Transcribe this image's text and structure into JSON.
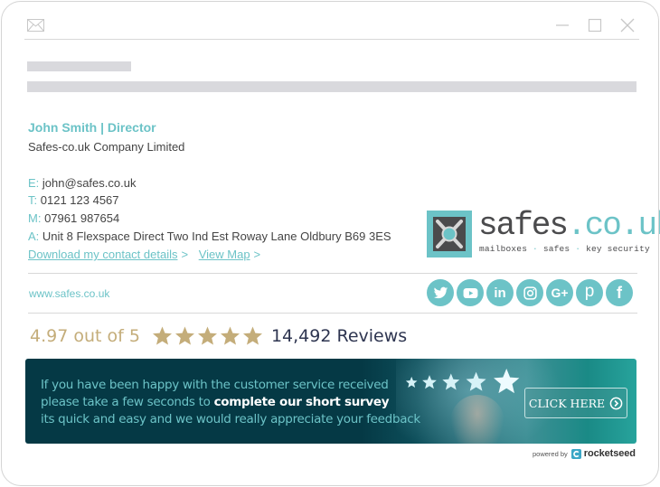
{
  "window": {
    "controls": [
      "minimize",
      "maximize",
      "close"
    ],
    "icon": "envelope-icon"
  },
  "signature": {
    "name_title": "John Smith | Director",
    "company": "Safes-co.uk Company Limited",
    "contacts": {
      "email": {
        "label": "E:",
        "value": "john@safes.co.uk"
      },
      "telephone": {
        "label": "T:",
        "value": "0121 123 4567"
      },
      "mobile": {
        "label": "M:",
        "value": "07961 987654"
      },
      "address": {
        "label": "A:",
        "value": "Unit 8 Flexspace Direct Two Ind Est Roway Lane Oldbury B69 3ES"
      }
    },
    "links": {
      "download": "Download my contact details",
      "download_arrow": ">",
      "map": "View Map",
      "map_arrow": ">"
    },
    "logo": {
      "name_main": "safes",
      "name_accent": ".co.uk",
      "tagline_1": "mailboxes",
      "tagline_2": "safes",
      "tagline_3": "key security",
      "tagline_sep": "·"
    },
    "website": "www.safes.co.uk",
    "socials": [
      {
        "name": "twitter",
        "icon": "twitter-icon"
      },
      {
        "name": "youtube",
        "icon": "youtube-icon"
      },
      {
        "name": "linkedin",
        "icon": "linkedin-icon",
        "glyph": "in"
      },
      {
        "name": "instagram",
        "icon": "instagram-icon"
      },
      {
        "name": "google-plus",
        "icon": "google-plus-icon",
        "glyph": "G+"
      },
      {
        "name": "pinterest",
        "icon": "pinterest-icon",
        "glyph": "p"
      },
      {
        "name": "facebook",
        "icon": "facebook-icon",
        "glyph": "f"
      }
    ]
  },
  "reviews": {
    "rating_text": "4.97 out of 5",
    "rating": 4.97,
    "max": 5,
    "count_text": "14,492 Reviews"
  },
  "banner": {
    "line1": "If you have been happy with the customer service received",
    "line2_prefix": "please take a few seconds to ",
    "line2_bold": "complete our short survey",
    "line3": "its quick and easy and we would really appreciate your feedback",
    "cta": "CLICK HERE"
  },
  "footer": {
    "powered_by": "powered by",
    "brand": "rocketseed"
  },
  "colors": {
    "accent": "#6cc3c7",
    "gold": "#c4ad7a",
    "navy": "#2e3550",
    "banner_bg": "#053945",
    "logo_dark": "#4b4b4d"
  }
}
